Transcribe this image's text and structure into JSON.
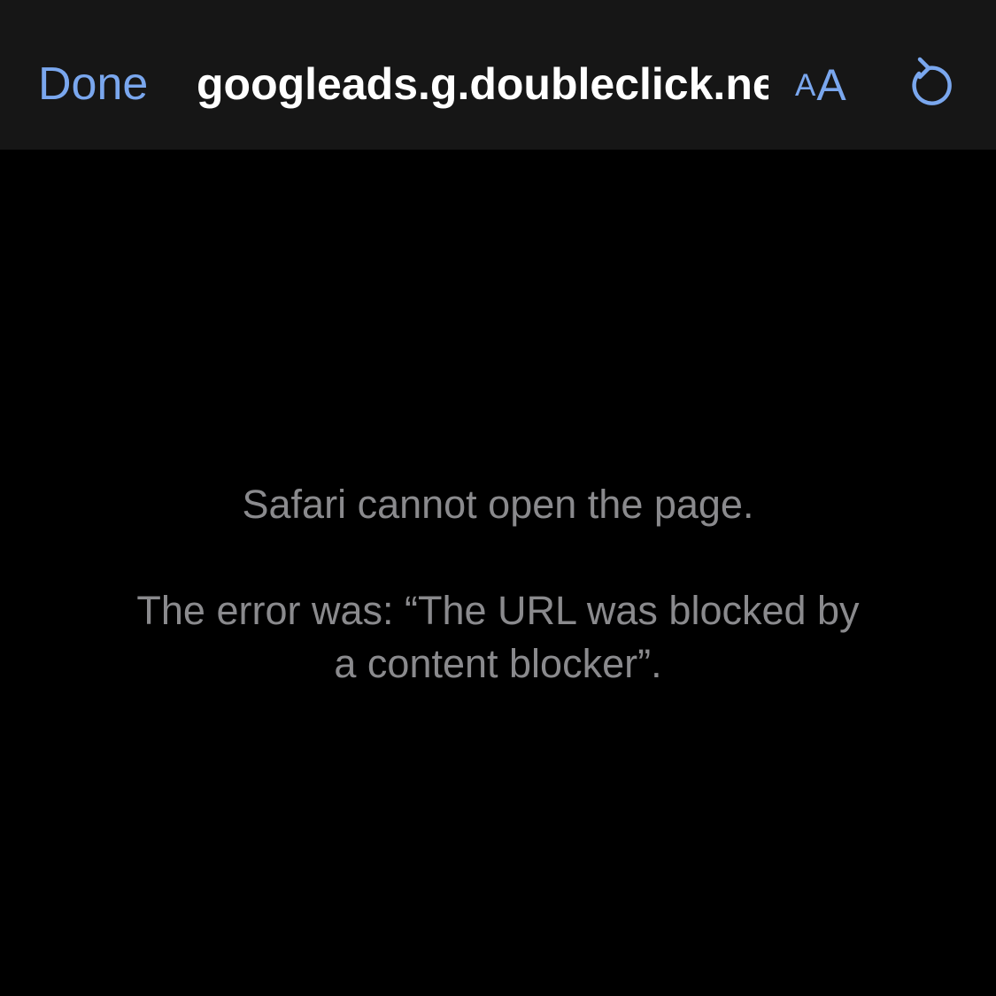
{
  "toolbar": {
    "done_label": "Done",
    "url_text": "googleads.g.doubleclick.net",
    "reader_small": "A",
    "reader_large": "A",
    "reload_icon": "reload-icon"
  },
  "error": {
    "title": "Safari cannot open the page.",
    "detail": "The error was: “The URL was blocked by a content blocker”."
  },
  "colors": {
    "accent": "#7aa7ee",
    "toolbar_background": "#161616",
    "page_background": "#000000",
    "url_text": "#ffffff",
    "error_text": "#8a8a8d"
  }
}
